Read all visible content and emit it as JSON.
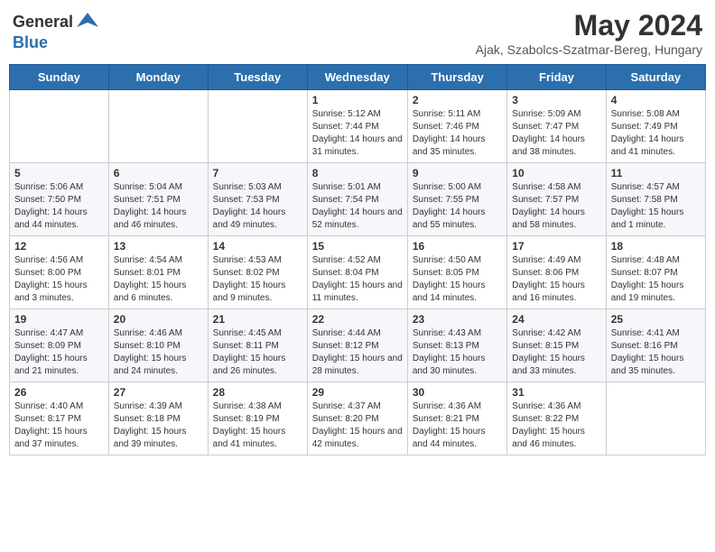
{
  "header": {
    "logo_general": "General",
    "logo_blue": "Blue",
    "title": "May 2024",
    "subtitle": "Ajak, Szabolcs-Szatmar-Bereg, Hungary"
  },
  "days_of_week": [
    "Sunday",
    "Monday",
    "Tuesday",
    "Wednesday",
    "Thursday",
    "Friday",
    "Saturday"
  ],
  "weeks": [
    [
      {
        "day": "",
        "info": ""
      },
      {
        "day": "",
        "info": ""
      },
      {
        "day": "",
        "info": ""
      },
      {
        "day": "1",
        "info": "Sunrise: 5:12 AM\nSunset: 7:44 PM\nDaylight: 14 hours and 31 minutes."
      },
      {
        "day": "2",
        "info": "Sunrise: 5:11 AM\nSunset: 7:46 PM\nDaylight: 14 hours and 35 minutes."
      },
      {
        "day": "3",
        "info": "Sunrise: 5:09 AM\nSunset: 7:47 PM\nDaylight: 14 hours and 38 minutes."
      },
      {
        "day": "4",
        "info": "Sunrise: 5:08 AM\nSunset: 7:49 PM\nDaylight: 14 hours and 41 minutes."
      }
    ],
    [
      {
        "day": "5",
        "info": "Sunrise: 5:06 AM\nSunset: 7:50 PM\nDaylight: 14 hours and 44 minutes."
      },
      {
        "day": "6",
        "info": "Sunrise: 5:04 AM\nSunset: 7:51 PM\nDaylight: 14 hours and 46 minutes."
      },
      {
        "day": "7",
        "info": "Sunrise: 5:03 AM\nSunset: 7:53 PM\nDaylight: 14 hours and 49 minutes."
      },
      {
        "day": "8",
        "info": "Sunrise: 5:01 AM\nSunset: 7:54 PM\nDaylight: 14 hours and 52 minutes."
      },
      {
        "day": "9",
        "info": "Sunrise: 5:00 AM\nSunset: 7:55 PM\nDaylight: 14 hours and 55 minutes."
      },
      {
        "day": "10",
        "info": "Sunrise: 4:58 AM\nSunset: 7:57 PM\nDaylight: 14 hours and 58 minutes."
      },
      {
        "day": "11",
        "info": "Sunrise: 4:57 AM\nSunset: 7:58 PM\nDaylight: 15 hours and 1 minute."
      }
    ],
    [
      {
        "day": "12",
        "info": "Sunrise: 4:56 AM\nSunset: 8:00 PM\nDaylight: 15 hours and 3 minutes."
      },
      {
        "day": "13",
        "info": "Sunrise: 4:54 AM\nSunset: 8:01 PM\nDaylight: 15 hours and 6 minutes."
      },
      {
        "day": "14",
        "info": "Sunrise: 4:53 AM\nSunset: 8:02 PM\nDaylight: 15 hours and 9 minutes."
      },
      {
        "day": "15",
        "info": "Sunrise: 4:52 AM\nSunset: 8:04 PM\nDaylight: 15 hours and 11 minutes."
      },
      {
        "day": "16",
        "info": "Sunrise: 4:50 AM\nSunset: 8:05 PM\nDaylight: 15 hours and 14 minutes."
      },
      {
        "day": "17",
        "info": "Sunrise: 4:49 AM\nSunset: 8:06 PM\nDaylight: 15 hours and 16 minutes."
      },
      {
        "day": "18",
        "info": "Sunrise: 4:48 AM\nSunset: 8:07 PM\nDaylight: 15 hours and 19 minutes."
      }
    ],
    [
      {
        "day": "19",
        "info": "Sunrise: 4:47 AM\nSunset: 8:09 PM\nDaylight: 15 hours and 21 minutes."
      },
      {
        "day": "20",
        "info": "Sunrise: 4:46 AM\nSunset: 8:10 PM\nDaylight: 15 hours and 24 minutes."
      },
      {
        "day": "21",
        "info": "Sunrise: 4:45 AM\nSunset: 8:11 PM\nDaylight: 15 hours and 26 minutes."
      },
      {
        "day": "22",
        "info": "Sunrise: 4:44 AM\nSunset: 8:12 PM\nDaylight: 15 hours and 28 minutes."
      },
      {
        "day": "23",
        "info": "Sunrise: 4:43 AM\nSunset: 8:13 PM\nDaylight: 15 hours and 30 minutes."
      },
      {
        "day": "24",
        "info": "Sunrise: 4:42 AM\nSunset: 8:15 PM\nDaylight: 15 hours and 33 minutes."
      },
      {
        "day": "25",
        "info": "Sunrise: 4:41 AM\nSunset: 8:16 PM\nDaylight: 15 hours and 35 minutes."
      }
    ],
    [
      {
        "day": "26",
        "info": "Sunrise: 4:40 AM\nSunset: 8:17 PM\nDaylight: 15 hours and 37 minutes."
      },
      {
        "day": "27",
        "info": "Sunrise: 4:39 AM\nSunset: 8:18 PM\nDaylight: 15 hours and 39 minutes."
      },
      {
        "day": "28",
        "info": "Sunrise: 4:38 AM\nSunset: 8:19 PM\nDaylight: 15 hours and 41 minutes."
      },
      {
        "day": "29",
        "info": "Sunrise: 4:37 AM\nSunset: 8:20 PM\nDaylight: 15 hours and 42 minutes."
      },
      {
        "day": "30",
        "info": "Sunrise: 4:36 AM\nSunset: 8:21 PM\nDaylight: 15 hours and 44 minutes."
      },
      {
        "day": "31",
        "info": "Sunrise: 4:36 AM\nSunset: 8:22 PM\nDaylight: 15 hours and 46 minutes."
      },
      {
        "day": "",
        "info": ""
      }
    ]
  ]
}
